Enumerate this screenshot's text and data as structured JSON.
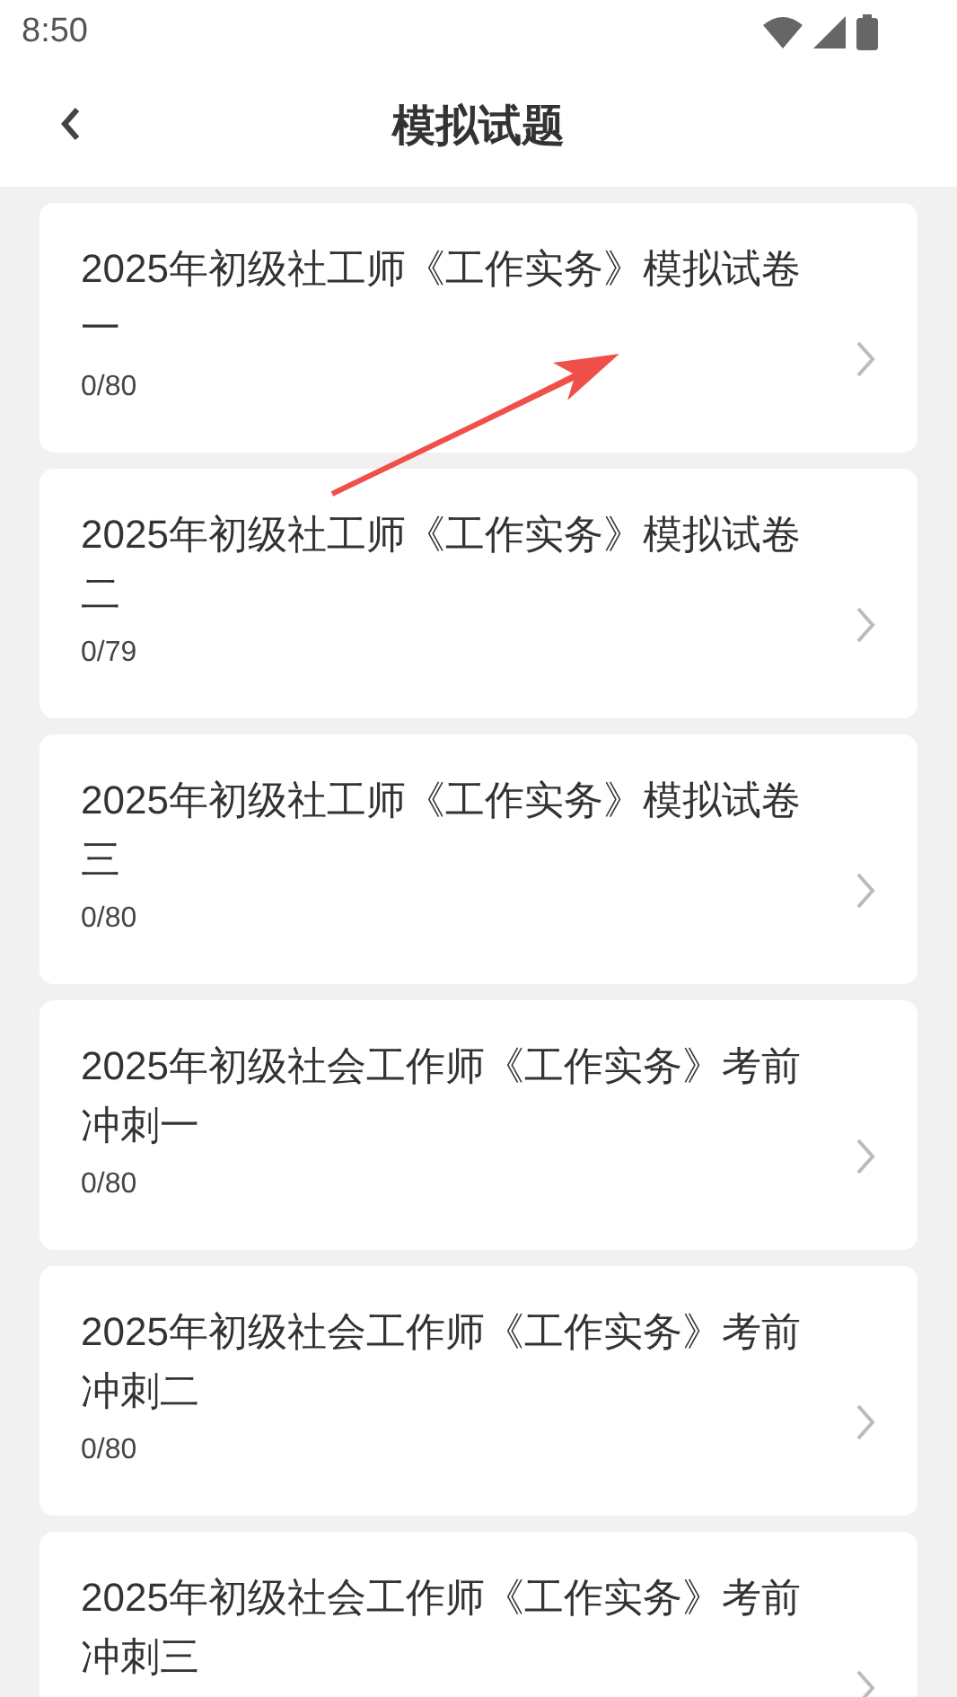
{
  "status_bar": {
    "time": "8:50"
  },
  "header": {
    "title": "模拟试题"
  },
  "items": [
    {
      "title": "2025年初级社工师《工作实务》模拟试卷一",
      "progress": "0/80"
    },
    {
      "title": "2025年初级社工师《工作实务》模拟试卷二",
      "progress": "0/79"
    },
    {
      "title": "2025年初级社工师《工作实务》模拟试卷三",
      "progress": "0/80"
    },
    {
      "title": "2025年初级社会工作师《工作实务》考前冲刺一",
      "progress": "0/80"
    },
    {
      "title": "2025年初级社会工作师《工作实务》考前冲刺二",
      "progress": "0/80"
    },
    {
      "title": "2025年初级社会工作师《工作实务》考前冲刺三"
    }
  ]
}
